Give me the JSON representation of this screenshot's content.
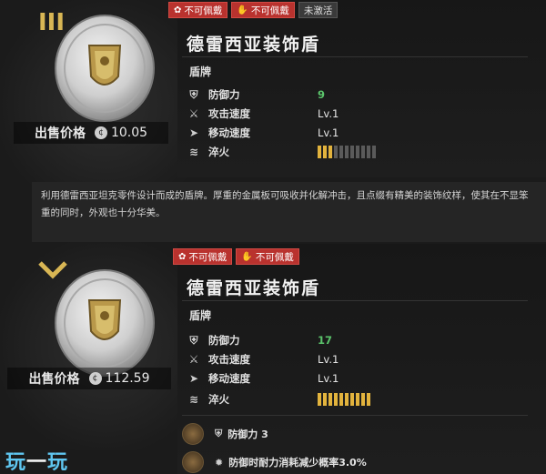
{
  "items": [
    {
      "rank_glyph": "III",
      "sell_label": "出售价格",
      "price": "10.05",
      "coin_glyph": "¢",
      "tags": [
        {
          "label": "不可佩戴",
          "icon": "pouch-icon",
          "style": "red"
        },
        {
          "label": "不可佩戴",
          "icon": "hand-icon",
          "style": "red"
        },
        {
          "label": "未激活",
          "icon": "",
          "style": "inactive"
        }
      ],
      "name": "德雷西亚装饰盾",
      "type": "盾牌",
      "stats": [
        {
          "icon": "shield-icon",
          "label": "防御力",
          "value": "9",
          "kind": "green"
        },
        {
          "icon": "attack-speed-icon",
          "label": "攻击速度",
          "value": "Lv.1",
          "kind": "text"
        },
        {
          "icon": "move-speed-icon",
          "label": "移动速度",
          "value": "Lv.1",
          "kind": "text"
        },
        {
          "icon": "temper-icon",
          "label": "淬火",
          "value_on": 3,
          "value_total": 11,
          "kind": "bar"
        }
      ],
      "description": "利用德雷西亚坦克零件设计而成的盾牌。厚重的金属板可吸收并化解冲击，且点缀有精美的装饰纹样，使其在不显笨重的同时，外观也十分华美。"
    },
    {
      "rank_glyph": "⌄",
      "sell_label": "出售价格",
      "price": "112.59",
      "coin_glyph": "¢",
      "tags": [
        {
          "label": "不可佩戴",
          "icon": "pouch-icon",
          "style": "red"
        },
        {
          "label": "不可佩戴",
          "icon": "hand-icon",
          "style": "red"
        }
      ],
      "name": "德雷西亚装饰盾",
      "type": "盾牌",
      "stats": [
        {
          "icon": "shield-icon",
          "label": "防御力",
          "value": "17",
          "kind": "green"
        },
        {
          "icon": "attack-speed-icon",
          "label": "攻击速度",
          "value": "Lv.1",
          "kind": "text"
        },
        {
          "icon": "move-speed-icon",
          "label": "移动速度",
          "value": "Lv.1",
          "kind": "text"
        },
        {
          "icon": "temper-icon",
          "label": "淬火",
          "value_on": 10,
          "value_total": 10,
          "kind": "bar"
        }
      ],
      "perks": [
        {
          "label": "防御力 3"
        },
        {
          "label": "防御时耐力消耗减少概率3.0%"
        }
      ]
    }
  ],
  "watermark": {
    "part1": "玩",
    "part2": "一",
    "part3": "玩"
  },
  "colors": {
    "accent_gold": "#e2b33d",
    "tag_red": "#b9322e",
    "value_green": "#5bc46b"
  }
}
